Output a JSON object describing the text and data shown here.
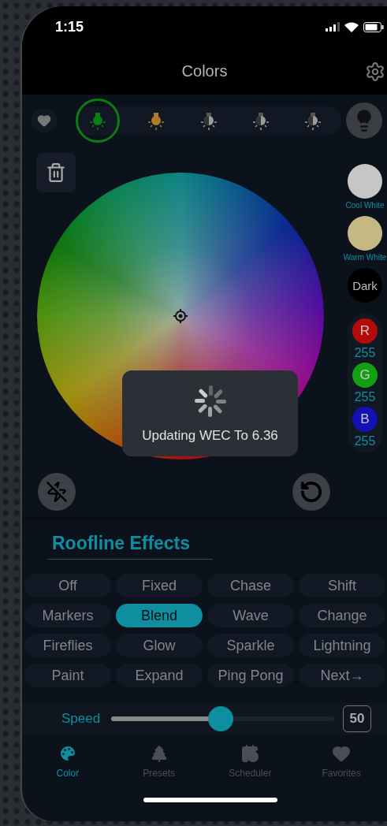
{
  "status_bar": {
    "time": "1:15"
  },
  "header": {
    "title": "Colors"
  },
  "bulbs": [
    {
      "color": "#0b7d12",
      "selected": true
    },
    {
      "color": "#b07a2a",
      "selected": false
    },
    {
      "color": "#9a9a9a",
      "selected": false
    },
    {
      "color": "#9a9a9a",
      "selected": false
    },
    {
      "color": "#9a9a9a",
      "selected": false
    }
  ],
  "swatches": [
    {
      "kind": "captioned",
      "label": "Cool White",
      "color": "#c6c6c6"
    },
    {
      "kind": "captioned",
      "label": "Warm White",
      "color": "#c4b985"
    },
    {
      "kind": "inside",
      "label": "Dark",
      "color": "#000000"
    }
  ],
  "channels": [
    {
      "letter": "R",
      "value": "255",
      "color": "#b40a0a"
    },
    {
      "letter": "G",
      "value": "255",
      "color": "#12a012"
    },
    {
      "letter": "B",
      "value": "255",
      "color": "#1212b4"
    }
  ],
  "toast": {
    "message": "Updating WEC To 6.36"
  },
  "effects": {
    "title": "Roofline Effects",
    "items": [
      {
        "label": "Off",
        "selected": false
      },
      {
        "label": "Fixed",
        "selected": false
      },
      {
        "label": "Chase",
        "selected": false
      },
      {
        "label": "Shift",
        "selected": false
      },
      {
        "label": "Markers",
        "selected": false
      },
      {
        "label": "Blend",
        "selected": true
      },
      {
        "label": "Wave",
        "selected": false
      },
      {
        "label": "Change",
        "selected": false
      },
      {
        "label": "Fireflies",
        "selected": false
      },
      {
        "label": "Glow",
        "selected": false
      },
      {
        "label": "Sparkle",
        "selected": false
      },
      {
        "label": "Lightning",
        "selected": false
      },
      {
        "label": "Paint",
        "selected": false
      },
      {
        "label": "Expand",
        "selected": false
      },
      {
        "label": "Ping Pong",
        "selected": false
      },
      {
        "label": "Next→",
        "selected": false
      }
    ]
  },
  "speed": {
    "label": "Speed",
    "level": 0.49,
    "value": "50"
  },
  "tabs": [
    {
      "label": "Color",
      "selected": true
    },
    {
      "label": "Presets",
      "selected": false
    },
    {
      "label": "Scheduler",
      "selected": false
    },
    {
      "label": "Favorites",
      "selected": false
    }
  ]
}
